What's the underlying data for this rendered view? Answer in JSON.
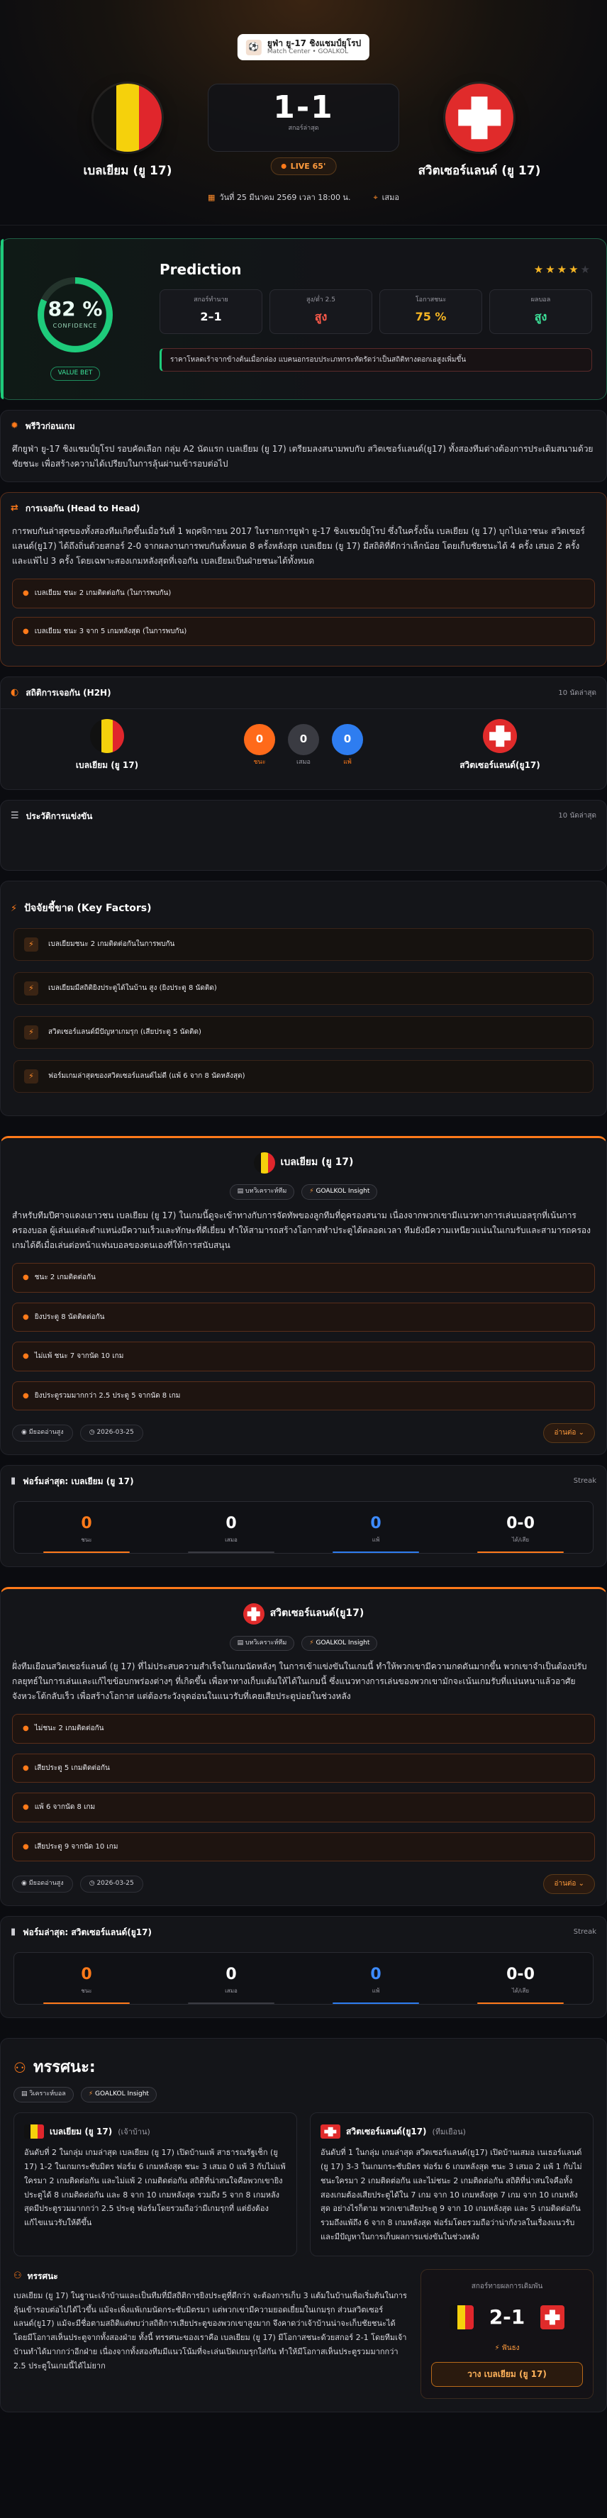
{
  "hero": {
    "league_name": "ยูฟ่า ยู-17 ชิงแชมป์ยุโรป",
    "league_sub": "Match Center • GOALKOL",
    "home_team": "เบลเยียม (ยู 17)",
    "away_team": "สวิตเซอร์แลนด์ (ยู 17)",
    "score": "1-1",
    "score_label": "สกอร์ล่าสุด",
    "status": "LIVE 65'",
    "date": "วันที่ 25 มีนาคม 2569 เวลา 18:00 น.",
    "venue": "เสมอ"
  },
  "prediction": {
    "title": "Prediction",
    "confidence": "82 %",
    "confidence_value": 82,
    "confidence_label": "CONFIDENCE",
    "value_bet": "VALUE BET",
    "stars_filled": 4,
    "stars_total": 5,
    "boxes": [
      {
        "label": "สกอร์ทำนาย",
        "value": "2–1",
        "color": "#ffffff"
      },
      {
        "label": "สูง/ต่ำ 2.5",
        "value": "สูง",
        "color": "#ff5a4a"
      },
      {
        "label": "โอกาสชนะ",
        "value": "75 %",
        "color": "#f5b524"
      },
      {
        "label": "ผลบอล",
        "value": "สูง",
        "color": "#3de39a"
      }
    ],
    "note": "ราคาโหลดเร้าจากข้างต้นเมื่อกล่อง แบคนอกรอบประเภทกระทัดรัดว่าเป็นสถิติทางดอกเอสูงเพิ่มขึ้น"
  },
  "preview": {
    "title": "พรีวิวก่อนเกม",
    "text": "ศึกยูฟ่า ยู-17 ชิงแชมป์ยุโรป รอบคัดเลือก กลุ่ม A2 นัดแรก เบลเยียม (ยู 17) เตรียมลงสนามพบกับ สวิตเซอร์แลนด์(ยู17) ทั้งสองทีมต่างต้องการประเดิมสนามด้วยชัยชนะ เพื่อสร้างความได้เปรียบในการลุ้นผ่านเข้ารอบต่อไป"
  },
  "h2h_section": {
    "title": "การเจอกัน (Head to Head)",
    "text": "การพบกันล่าสุดของทั้งสองทีมเกิดขึ้นเมื่อวันที่ 1 พฤศจิกายน 2017 ในรายการยูฟ่า ยู-17 ชิงแชมป์ยุโรป ซึ่งในครั้งนั้น เบลเยียม (ยู 17) บุกไปเอาชนะ สวิตเซอร์แลนด์(ยู17) ได้ถึงถิ่นด้วยสกอร์ 2-0 จากผลงานการพบกันทั้งหมด 8 ครั้งหลังสุด เบลเยียม (ยู 17) มีสถิติที่ดีกว่าเล็กน้อย โดยเก็บชัยชนะได้ 4 ครั้ง เสมอ 2 ครั้ง และแพ้ไป 3 ครั้ง โดยเฉพาะสองเกมหลังสุดที่เจอกัน เบลเยียมเป็นฝ่ายชนะได้ทั้งหมด",
    "alerts": [
      "เบลเยียม ชนะ 2 เกมติดต่อกัน (ในการพบกัน)",
      "เบลเยียม ชนะ 3 จาก 5 เกมหลังสุด (ในการพบกัน)"
    ]
  },
  "h2h_stats": {
    "title": "สถิติการเจอกัน (H2H)",
    "count": "10 นัดล่าสุด",
    "home": "เบลเยียม (ยู 17)",
    "away": "สวิตเซอร์แลนด์(ยู17)",
    "wins": "0",
    "wins_label": "ชนะ",
    "draws": "0",
    "draws_label": "เสมอ",
    "losses": "0",
    "losses_label": "แพ้"
  },
  "history": {
    "title": "ประวัติการแข่งขัน",
    "count": "10 นัดล่าสุด"
  },
  "key_factors": {
    "title": "ปัจจัยชี้ขาด (Key Factors)",
    "items": [
      "เบลเยียมชนะ 2 เกมติดต่อกันในการพบกัน",
      "เบลเยียมมีสถิติยิงประตูได้ในบ้าน สูง (ยิงประตู 8 นัดติด)",
      "สวิตเซอร์แลนด์มีปัญหาเกมรุก (เสียประตู 5 นัดติด)",
      "ฟอร์มเกมล่าสุดของสวิตเซอร์แลนด์ไม่ดี (แพ้ 6 จาก 8 นัดหลังสุด)"
    ]
  },
  "home_card": {
    "name": "เบลเยียม (ยู 17)",
    "tag1": "บทวิเคราะห์ทีม",
    "tag2": "GOALKOL Insight",
    "text": "สำหรับทีมปีศาจแดงเยาวชน เบลเยียม (ยู 17) ในเกมนี้ดูจะเข้าทางกับการจัดทัพของลูกทีมที่ดูครองสนาม เนื่องจากพวกเขามีแนวทางการเล่นบอลรุกที่เน้นการครองบอล ผู้เล่นแต่ละตำแหน่งมีความเร็วและทักษะที่ดีเยี่ยม ทำให้สามารถสร้างโอกาสทำประตูได้ตลอดเวลา ทีมยังมีความเหนียวแน่นในเกมรับและสามารถครองเกมได้ดีเมื่อเล่นต่อหน้าแฟนบอลของตนเองที่ให้การสนับสนุน",
    "points": [
      "ชนะ 2 เกมติดต่อกัน",
      "ยิงประตู 8 นัดติดต่อกัน",
      "ไม่แพ้ ชนะ 7 จากนัด 10 เกม",
      "ยิงประตูรวมมากกว่า 2.5 ประตู 5 จากนัด 8 เกม"
    ],
    "views": "มียอดอ่านสูง",
    "date": "2026-03-25",
    "read_more": "อ่านต่อ"
  },
  "home_form": {
    "title": "ฟอร์มล่าสุด: เบลเยียม (ยู 17)",
    "badge": "Streak",
    "wins": "0",
    "wins_label": "ชนะ",
    "draws": "0",
    "draws_label": "เสมอ",
    "losses": "0",
    "losses_label": "แพ้",
    "goals": "0-0",
    "goals_label": "ได้/เสีย"
  },
  "away_card": {
    "name": "สวิตเซอร์แลนด์(ยู17)",
    "tag1": "บทวิเคราะห์ทีม",
    "tag2": "GOALKOL Insight",
    "text": "ฝั่งทีมเยือนสวิตเซอร์แลนด์ (ยู 17) ที่ไม่ประสบความสำเร็จในเกมนัดหลังๆ ในการเข้าแข่งขันในเกมนี้ ทำให้พวกเขามีความกดดันมากขึ้น พวกเขาจำเป็นต้องปรับกลยุทธ์ในการเล่นและแก้ไขข้อบกพร่องต่างๆ ที่เกิดขึ้น เพื่อหาทางเก็บแต้มให้ได้ในเกมนี้ ซึ่งแนวทางการเล่นของพวกเขามักจะเน้นเกมรับที่แน่นหนาแล้วอาศัยจังหวะโต้กลับเร็ว เพื่อสร้างโอกาส แต่ต้องระวังจุดอ่อนในแนวรับที่เคยเสียประตูบ่อยในช่วงหลัง",
    "points": [
      "ไม่ชนะ 2 เกมติดต่อกัน",
      "เสียประตู 5 เกมติดต่อกัน",
      "แพ้ 6 จากนัด 8 เกม",
      "เสียประตู 9 จากนัด 10 เกม"
    ],
    "views": "มียอดอ่านสูง",
    "date": "2026-03-25",
    "read_more": "อ่านต่อ"
  },
  "away_form": {
    "title": "ฟอร์มล่าสุด: สวิตเซอร์แลนด์(ยู17)",
    "badge": "Streak",
    "wins": "0",
    "wins_label": "ชนะ",
    "draws": "0",
    "draws_label": "เสมอ",
    "losses": "0",
    "losses_label": "แพ้",
    "goals": "0-0",
    "goals_label": "ได้/เสีย"
  },
  "analysis": {
    "title": "ทรรศนะ:",
    "tag1": "วิเคราะห์บอล",
    "tag2": "GOALKOL Insight",
    "home_head": "เบลเยียม (ยู 17)",
    "home_sub": "(เจ้าบ้าน)",
    "home_text": "อันดับที่ 2 ในกลุ่ม เกมล่าสุด เบลเยียม (ยู 17) เปิดบ้านแพ้ สาธารณรัฐเช็ก (ยู 17) 1-2 ในเกมกระชับมิตร ฟอร์ม 6 เกมหลังสุด ชนะ 3 เสมอ 0 แพ้ 3 กับไม่แพ้ใครมา 2 เกมติดต่อกัน และไม่แพ้ 2 เกมติดต่อกัน สถิติที่น่าสนใจคือพวกเขายิงประตูได้ 8 เกมติดต่อกัน และ 8 จาก 10 เกมหลังสุด รวมถึง 5 จาก 8 เกมหลังสุดมีประตูรวมมากกว่า 2.5 ประตู ฟอร์มโดยรวมถือว่ามีเกมรุกที่ แต่ยังต้องแก้ไขแนวรับให้ดีขึ้น",
    "away_head": "สวิตเซอร์แลนด์(ยู17)",
    "away_sub": "(ทีมเยือน)",
    "away_text": "อันดับที่ 1 ในกลุ่ม เกมล่าสุด สวิตเซอร์แลนด์(ยู17) เปิดบ้านเสมอ เนเธอร์แลนด์ (ยู 17) 3-3 ในเกมกระชับมิตร ฟอร์ม 6 เกมหลังสุด ชนะ 3 เสมอ 2 แพ้ 1 กับไม่ชนะใครมา 2 เกมติดต่อกัน และไม่ชนะ 2 เกมติดต่อกัน สถิติที่น่าสนใจคือทั้งสองเกมต้องเสียประตูได้ใน 7 เกม จาก 10 เกมหลังสุด 7 เกม จาก 10 เกมหลังสุด อย่างไรก็ตาม พวกเขาเสียประตู 9 จาก 10 เกมหลังสุด และ 5 เกมติดต่อกัน รวมถึงแพ้ถึง 6 จาก 8 เกมหลังสุด ฟอร์มโดยรวมถือว่าน่ากังวลในเรื่องแนวรับ และมีปัญหาในการเก็บผลการแข่งขันในช่วงหลัง",
    "final_head": "ทรรศนะ",
    "final_text": "เบลเยียม (ยู 17) ในฐานะเจ้าบ้านและเป็นทีมที่มีสถิติการยิงประตูที่ดีกว่า จะต้องการเก็บ 3 แต้มในบ้านเพื่อเริ่มต้นในการลุ้นเข้ารอบต่อไปได้ไวขึ้น แม้จะเพิ่งแพ้เกมนัดกระชับมิตรมา แต่พวกเขามีความยอดเยี่ยมในเกมรุก ส่วนสวิตเซอร์แลนด์(ยู17) แม้จะมีชื่อตามสถิติแต่พบว่าสถิติการเสียประตูของพวกเขาสูงมาก จึงคาดว่าเจ้าบ้านน่าจะเก็บชัยชนะได้ โดยมีโอกาสเห็นประตูจากทั้งสองฝ่าย ทั้งนี้ ทรรศนะของเราคือ เบลเยียม (ยู 17) มีโอกาสชนะด้วยสกอร์ 2-1 โดยทีมเจ้าบ้านทำได้มากกว่าอีกฝ่าย เนื่องจากทั้งสองทีมมีแนวโน้มที่จะเล่นเปิดเกมรุกใส่กัน ทำให้มีโอกาสเห็นประตูรวมมากกว่า 2.5 ประตูในเกมนี้ได้ไม่ยาก",
    "pred_label": "สกอร์ทายผลการเดิมพัน",
    "pred_score": "2-1",
    "pred_tip": "ฟันธง",
    "pred_btn": "วาง เบลเยียม (ยู 17)"
  }
}
